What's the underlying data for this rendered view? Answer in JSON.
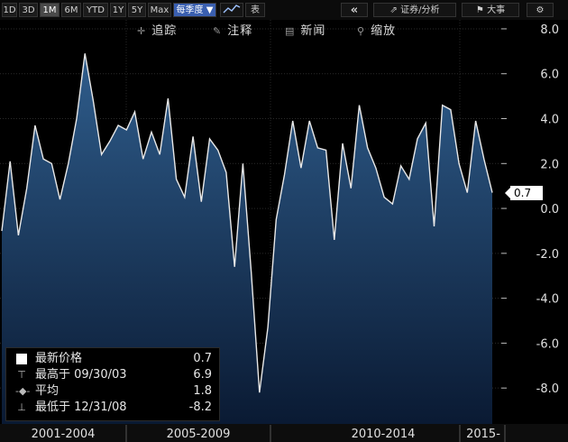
{
  "toolbar": {
    "periods": [
      "1D",
      "3D",
      "1M",
      "6M",
      "YTD",
      "1Y",
      "5Y",
      "Max"
    ],
    "selected_period": "1M",
    "frequency_label": "每季度",
    "chart_icon": "line-chart-icon",
    "table_label": "表",
    "back_icon": "double-chevron-left-icon",
    "securities_label": "证券/分析",
    "flag_label": "大事",
    "gear_icon": "gear-icon"
  },
  "subtoolbar": {
    "track_label": "追踪",
    "annotate_label": "注释",
    "news_label": "新闻",
    "zoom_label": "缩放"
  },
  "legend": {
    "last_label": "最新价格",
    "last_value": "0.7",
    "high_label": "最高于 09/30/03",
    "high_value": "6.9",
    "avg_label": "平均",
    "avg_value": "1.8",
    "low_label": "最低于 12/31/08",
    "low_value": "-8.2"
  },
  "last_badge": "0.7",
  "colors": {
    "line": "#e8e8e8",
    "fill_top": "#2f5d8c",
    "fill_bottom": "#0a1a33",
    "background": "#000000"
  },
  "chart_data": {
    "type": "area",
    "ylim": [
      -9.6,
      8.4
    ],
    "yticks": [
      8,
      6,
      4,
      2,
      0,
      -2,
      -4,
      -6,
      -8
    ],
    "ytick_labels": [
      "8.0",
      "6.0",
      "4.0",
      "2.0",
      "0.0",
      "-2.0",
      "-4.0",
      "-6.0",
      "-8.0"
    ],
    "x_groups": [
      "2001-2004",
      "2005-2009",
      "2010-2014",
      "2015-"
    ],
    "values": [
      -1.0,
      2.1,
      -1.2,
      0.9,
      3.7,
      2.2,
      2.0,
      0.4,
      2.0,
      4.0,
      6.9,
      4.8,
      2.4,
      3.0,
      3.7,
      3.5,
      4.3,
      2.2,
      3.4,
      2.4,
      4.9,
      1.3,
      0.5,
      3.2,
      0.3,
      3.1,
      2.6,
      1.6,
      -2.6,
      2.0,
      -2.8,
      -8.2,
      -5.3,
      -0.5,
      1.5,
      3.9,
      1.8,
      3.9,
      2.7,
      2.6,
      -1.4,
      2.9,
      0.9,
      4.6,
      2.7,
      1.8,
      0.5,
      0.2,
      1.9,
      1.3,
      3.1,
      3.8,
      -0.8,
      4.6,
      4.4,
      2.0,
      0.7,
      3.9,
      2.2,
      0.7
    ]
  }
}
